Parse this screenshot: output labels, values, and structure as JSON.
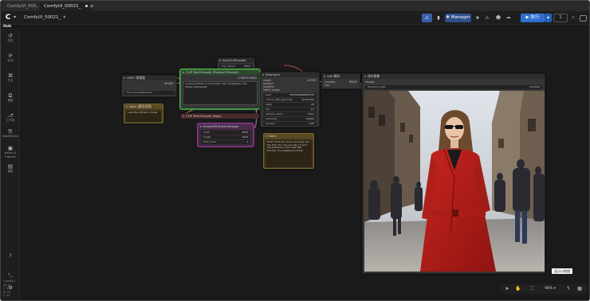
{
  "browser": {
    "tabs": [
      {
        "label": "ComfyUI_000...",
        "active": false
      },
      {
        "label": "ComfyUI_00021_",
        "active": true
      }
    ],
    "add_tab_icon": "plus-icon"
  },
  "topbar": {
    "workflow_label": "ComfyUI_00021_",
    "manager_label": "Manager",
    "run_label": "执行",
    "run_count": "1",
    "accent": "#2d6fd0"
  },
  "brand_label": "Hub",
  "sidebar": {
    "items": [
      {
        "icon": "history-icon",
        "label": "历史"
      },
      {
        "icon": "queue-icon",
        "label": "队列"
      },
      {
        "icon": "node-library-icon",
        "label": "节点"
      },
      {
        "icon": "model-library-icon",
        "label": "模型"
      },
      {
        "icon": "workflow-icon",
        "label": "工作流"
      },
      {
        "icon": "bookmark-icon",
        "label": "Bookmarks"
      },
      {
        "icon": "gallery-icon",
        "label": "Nodes & Outputs"
      },
      {
        "icon": "template-icon",
        "label": "模板"
      }
    ],
    "bottom": [
      {
        "icon": "help-icon"
      },
      {
        "icon": "terminal-icon"
      },
      {
        "icon": "settings-icon"
      }
    ],
    "version_lines": [
      "ComfyUI",
      "v0.3",
      "T: 0.01",
      "N: 12",
      "L: 12",
      "FPS: 60.00"
    ]
  },
  "nodes": {
    "clip_pos": {
      "title": "CLIP Text Encode (Positive Prompt)",
      "id": "#6",
      "text": "a young woman in red trench coat, sunglasses, city street, photograph",
      "out": "CONDITIONING"
    },
    "clip_neg": {
      "title": "CLIP Text Encode (Neg)",
      "id": "#7"
    },
    "latent": {
      "title": "EmptySD3LatentImage",
      "id": "#27",
      "widgets": [
        {
          "name": "width",
          "val": "1024"
        },
        {
          "name": "height",
          "val": "1024"
        },
        {
          "name": "batch_size",
          "val": "1"
        }
      ]
    },
    "unet": {
      "title": "UNET 加载器",
      "id": "#12",
      "widget": "flux1-dev.safetensors",
      "out": "MODEL"
    },
    "note1": {
      "title": "Note (模型说明)",
      "text": "Load the diffusion model"
    },
    "clipload": {
      "title": "DualCLIPLoader",
      "id": "#11",
      "widgets": [
        {
          "name": "clip_name1",
          "val": "t5xxl"
        },
        {
          "name": "type",
          "val": "flux"
        }
      ]
    },
    "ksampler": {
      "title": "KSampler",
      "id": "#3",
      "inputs": [
        "model",
        "positive",
        "negative",
        "latent_image"
      ],
      "widgets": [
        {
          "name": "seed",
          "val": "6545484984983158"
        },
        {
          "name": "control_after_generate",
          "val": "randomize"
        },
        {
          "name": "steps",
          "val": "20"
        },
        {
          "name": "cfg",
          "val": "1.0"
        },
        {
          "name": "sampler_name",
          "val": "euler"
        },
        {
          "name": "scheduler",
          "val": "simple"
        },
        {
          "name": "denoise",
          "val": "1.00"
        }
      ],
      "out": "LATENT"
    },
    "note2": {
      "title": "Note",
      "text": "Note: FLUX dev does not really use the CFG. You can use cfg 1.0 and set guidance in the CLIP Text Encode. Try negative prompts."
    },
    "vae": {
      "title": "VAE 解码",
      "id": "#8",
      "inputs": [
        "samples",
        "vae"
      ],
      "out": "IMAGE"
    },
    "preview": {
      "title": "保存图像",
      "id": "#9",
      "input": "images",
      "widget": "filename_prefix",
      "widget_val": "ComfyUI"
    }
  },
  "canvas_controls": {
    "zoom": "98%",
    "tooltip": "显示小地图"
  }
}
